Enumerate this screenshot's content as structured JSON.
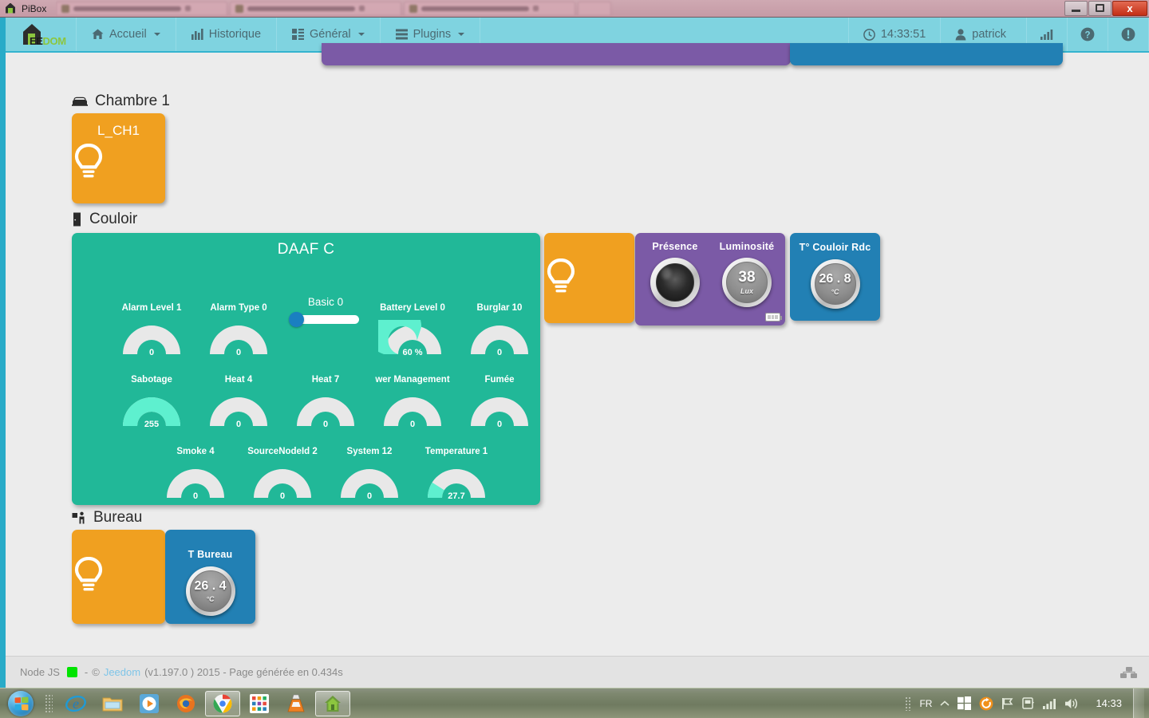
{
  "window": {
    "title": "PiBox",
    "buttons": {
      "minimize": "",
      "maximize": "",
      "close": "x"
    }
  },
  "navbar": {
    "brand": {
      "ee": "EE",
      "dom": "DOM"
    },
    "items": [
      {
        "label": "Accueil",
        "icon": "home-icon",
        "caret": true
      },
      {
        "label": "Historique",
        "icon": "bar-chart-icon",
        "caret": false
      },
      {
        "label": "Général",
        "icon": "grid-icon",
        "caret": true
      },
      {
        "label": "Plugins",
        "icon": "list-icon",
        "caret": true
      }
    ],
    "right": [
      {
        "label": "14:33:51",
        "icon": "clock-icon",
        "name": "clock"
      },
      {
        "label": "patrick",
        "icon": "user-icon",
        "name": "user-menu",
        "caret": true
      },
      {
        "label": "",
        "icon": "signal-icon",
        "name": "signal"
      },
      {
        "label": "",
        "icon": "question-icon",
        "name": "help"
      },
      {
        "label": "",
        "icon": "info-icon",
        "name": "info"
      }
    ]
  },
  "groups": [
    {
      "name": "Chambre 1",
      "icon": "bed-icon"
    },
    {
      "name": "Couloir",
      "icon": "door-icon"
    },
    {
      "name": "Bureau",
      "icon": "desk-icon"
    }
  ],
  "tiles": {
    "light_ch1": {
      "label": "L_CH1",
      "icon": "lightbulb-icon",
      "color": "#f0a020"
    },
    "light_couloir": {
      "label": "",
      "icon": "lightbulb-icon",
      "color": "#f0a020"
    },
    "light_bureau": {
      "label": "",
      "icon": "lightbulb-icon",
      "color": "#f0a020"
    },
    "presence_panel": {
      "color": "#7b5aa6",
      "widgets": [
        {
          "title": "Présence",
          "type": "dark-dial",
          "value": "",
          "unit": ""
        },
        {
          "title": "Luminosité",
          "type": "grey-dial",
          "value": "38",
          "unit": "Lux"
        }
      ],
      "battery_badge": "battery-icon"
    },
    "temp_couloir": {
      "title": "T° Couloir Rdc",
      "color": "#2280b4",
      "value": "26 . 8",
      "unit": "°C"
    },
    "temp_bureau": {
      "title": "T Bureau",
      "color": "#2280b4",
      "value": "26 . 4",
      "unit": "°C"
    }
  },
  "daaf": {
    "title": "DAAF C",
    "color": "#21b898",
    "gauge_fill": "#5ef0cf",
    "gauge_track": "#e8e8e8",
    "rows": [
      [
        {
          "type": "gauge",
          "label": "Alarm Level 1",
          "value": "0",
          "percent": 0
        },
        {
          "type": "gauge",
          "label": "Alarm Type 0",
          "value": "0",
          "percent": 0
        },
        {
          "type": "slider",
          "label": "Basic 0",
          "value": 0
        },
        {
          "type": "gauge",
          "label": "Battery Level 0",
          "value": "60 %",
          "percent": 60
        },
        {
          "type": "gauge",
          "label": "Burglar 10",
          "value": "0",
          "percent": 0
        }
      ],
      [
        {
          "type": "gauge",
          "label": "Sabotage",
          "value": "255",
          "percent": 100
        },
        {
          "type": "gauge",
          "label": "Heat 4",
          "value": "0",
          "percent": 0
        },
        {
          "type": "gauge",
          "label": "Heat 7",
          "value": "0",
          "percent": 0
        },
        {
          "type": "gauge",
          "label": "wer Management",
          "value": "0",
          "percent": 0
        },
        {
          "type": "gauge",
          "label": "Fumée",
          "value": "0",
          "percent": 0
        }
      ],
      [
        {
          "type": "gauge",
          "label": "Smoke 4",
          "value": "0",
          "percent": 0
        },
        {
          "type": "gauge",
          "label": "SourceNodeId 2",
          "value": "0",
          "percent": 0
        },
        {
          "type": "gauge",
          "label": "System 12",
          "value": "0",
          "percent": 0
        },
        {
          "type": "gauge",
          "label": "Temperature 1",
          "value": "27.7",
          "percent": 18
        }
      ]
    ]
  },
  "footer": {
    "node_label": "Node JS",
    "sep1": "-",
    "copyright": "©",
    "link": "Jeedom",
    "version": "(v1.197.0 ) 2015 - Page générée en 0.434s",
    "dot_color": "#00e400"
  },
  "taskbar": {
    "start": "start-orb",
    "items": [
      {
        "name": "internet-explorer-icon",
        "active": false
      },
      {
        "name": "file-explorer-icon",
        "active": false
      },
      {
        "name": "media-player-icon",
        "active": false
      },
      {
        "name": "firefox-icon",
        "active": false
      },
      {
        "name": "chrome-icon",
        "active": true
      },
      {
        "name": "apps-grid-icon",
        "active": false
      },
      {
        "name": "vlc-icon",
        "active": false
      },
      {
        "name": "jeedom-app-icon",
        "active": true
      }
    ],
    "tray": {
      "language": "FR",
      "icons": [
        "show-hidden-icon",
        "windows-store-icon",
        "update-icon",
        "flag-icon",
        "device-icon",
        "network-icon",
        "volume-icon"
      ],
      "clock": "14:33"
    }
  }
}
